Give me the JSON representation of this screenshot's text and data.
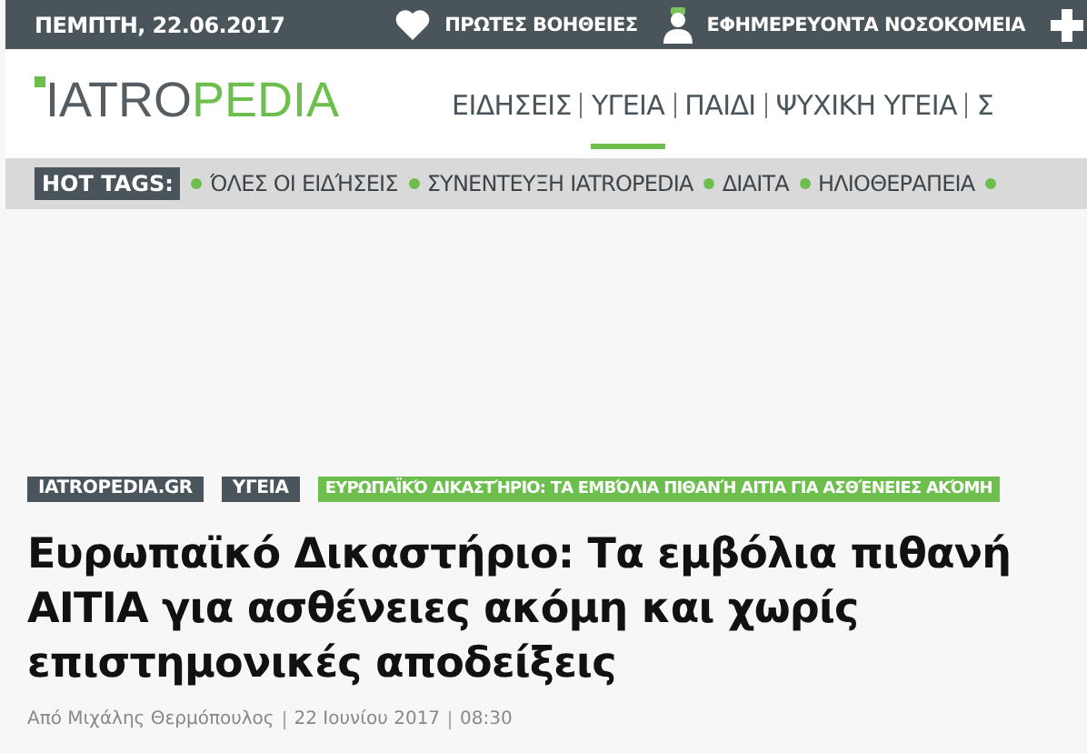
{
  "top_bar": {
    "date": "ΠΕΜΠΤΗ, 22.06.2017",
    "links": [
      {
        "kind": "heart",
        "label": "ΠΡΩΤΕΣ ΒΟΗΘΕΙΕΣ"
      },
      {
        "kind": "doctor",
        "label": "ΕΦΗΜΕΡΕΥΟΝΤΑ ΝΟΣΟΚΟΜΕΙΑ"
      },
      {
        "kind": "cross"
      }
    ]
  },
  "logo": {
    "dark_part": "IATRO",
    "green_part": "PEDIA"
  },
  "nav": [
    {
      "label": "ΕΙΔΗΣΕΙΣ",
      "selected": false
    },
    {
      "label": "ΥΓΕΙΑ",
      "selected": true
    },
    {
      "label": "ΠΑΙΔΙ",
      "selected": false
    },
    {
      "label": "ΨΥΧΙΚΗ ΥΓΕΙΑ",
      "selected": false
    },
    {
      "label": "Σ",
      "selected": false
    }
  ],
  "hot_tags": {
    "label": "HOT TAGS:",
    "tags": [
      "ΌΛΕΣ ΟΙ ΕΙΔΉΣΕΙΣ",
      "ΣΥΝΕΝΤΕΥΞΗ IATROPEDIA",
      "ΔΙΑΙΤΑ",
      "ΗΛΙΟΘΕΡΑΠΕΙΑ"
    ]
  },
  "breadcrumbs": [
    {
      "label": "IATROPEDIA.GR",
      "kind": "dark"
    },
    {
      "label": "ΥΓΕΙΑ",
      "kind": "dark"
    },
    {
      "label": "ΕΥΡΩΠΑΪΚΌ ΔΙΚΑΣΤΉΡΙΟ: ΤΑ ΕΜΒΌΛΙΑ ΠΙΘΑΝΉ ΑΙΤΙΑ ΓΙΑ ΑΣΘΈΝΕΙΕΣ ΑΚΌΜΗ",
      "kind": "green"
    }
  ],
  "article": {
    "title": "Ευρωπαϊκό Δικαστήριο: Τα εμβόλια πιθανή ΑΙΤΙΑ για ασθένειες ακόμη και χωρίς επιστημονικές αποδείξεις",
    "author": "Από Μιχάλης Θερμόπουλος",
    "date": "22 Ιουνίου 2017",
    "time": "08:30"
  }
}
